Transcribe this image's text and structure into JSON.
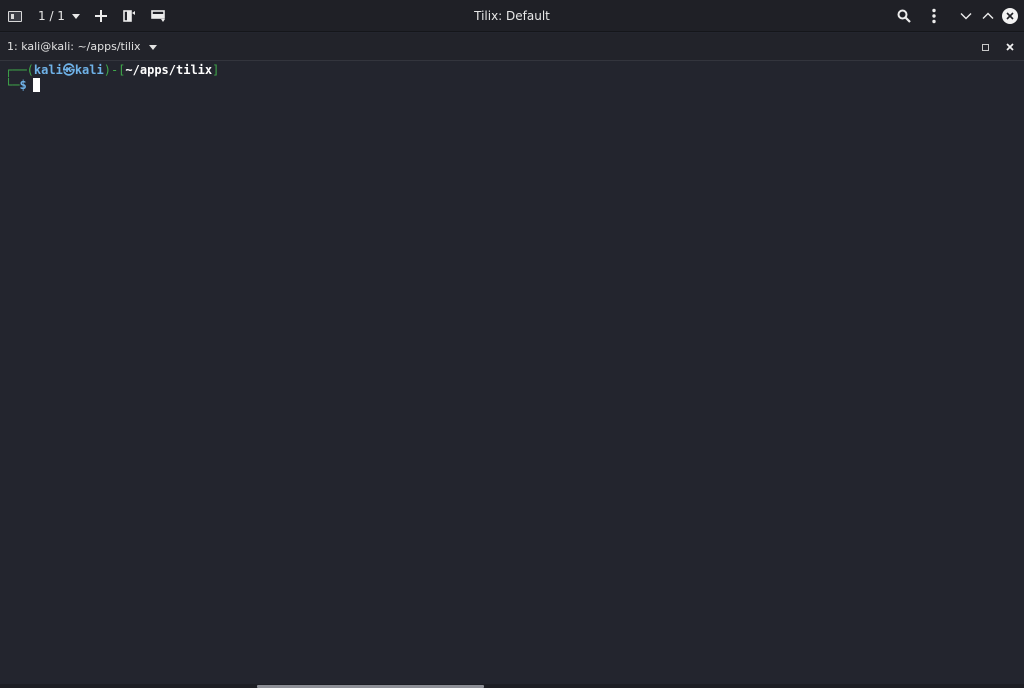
{
  "header": {
    "session_counter": "1 / 1",
    "window_title": "Tilix: Default",
    "icons": {
      "sidebar": "sidebar-toggle-icon",
      "add": "plus-icon",
      "split_right": "split-horizontal-icon",
      "split_down": "split-vertical-icon",
      "search": "search-icon",
      "menu": "vertical-dots-icon",
      "minimize": "chevron-down-icon",
      "maximize": "chevron-up-icon",
      "close": "close-icon"
    }
  },
  "terminal_tab": {
    "title": "1: kali@kali: ~/apps/tilix"
  },
  "terminal": {
    "prompt": {
      "corner_top": "┌──(",
      "user": "kali",
      "at_symbol": "㉿",
      "host": "kali",
      "mid": ")-[",
      "path": "~/apps/tilix",
      "end": "]",
      "corner_bottom": "└─",
      "symbol": "$"
    }
  },
  "colors": {
    "background": "#23252e",
    "prompt_green": "#3fa84a",
    "prompt_blue": "#6fb2e8",
    "text": "#ffffff"
  }
}
